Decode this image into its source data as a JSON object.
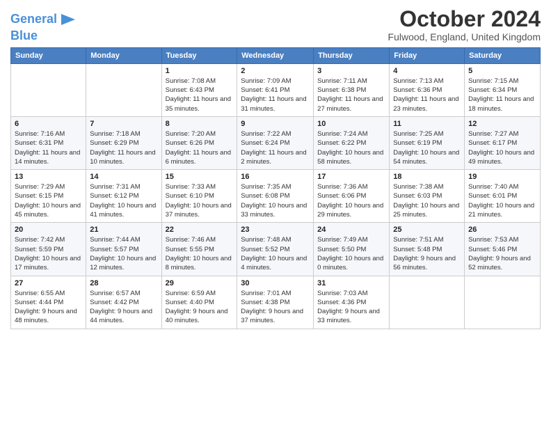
{
  "logo": {
    "line1": "General",
    "line2": "Blue"
  },
  "title": "October 2024",
  "location": "Fulwood, England, United Kingdom",
  "days_of_week": [
    "Sunday",
    "Monday",
    "Tuesday",
    "Wednesday",
    "Thursday",
    "Friday",
    "Saturday"
  ],
  "weeks": [
    [
      {
        "day": "",
        "info": ""
      },
      {
        "day": "",
        "info": ""
      },
      {
        "day": "1",
        "info": "Sunrise: 7:08 AM\nSunset: 6:43 PM\nDaylight: 11 hours and 35 minutes."
      },
      {
        "day": "2",
        "info": "Sunrise: 7:09 AM\nSunset: 6:41 PM\nDaylight: 11 hours and 31 minutes."
      },
      {
        "day": "3",
        "info": "Sunrise: 7:11 AM\nSunset: 6:38 PM\nDaylight: 11 hours and 27 minutes."
      },
      {
        "day": "4",
        "info": "Sunrise: 7:13 AM\nSunset: 6:36 PM\nDaylight: 11 hours and 23 minutes."
      },
      {
        "day": "5",
        "info": "Sunrise: 7:15 AM\nSunset: 6:34 PM\nDaylight: 11 hours and 18 minutes."
      }
    ],
    [
      {
        "day": "6",
        "info": "Sunrise: 7:16 AM\nSunset: 6:31 PM\nDaylight: 11 hours and 14 minutes."
      },
      {
        "day": "7",
        "info": "Sunrise: 7:18 AM\nSunset: 6:29 PM\nDaylight: 11 hours and 10 minutes."
      },
      {
        "day": "8",
        "info": "Sunrise: 7:20 AM\nSunset: 6:26 PM\nDaylight: 11 hours and 6 minutes."
      },
      {
        "day": "9",
        "info": "Sunrise: 7:22 AM\nSunset: 6:24 PM\nDaylight: 11 hours and 2 minutes."
      },
      {
        "day": "10",
        "info": "Sunrise: 7:24 AM\nSunset: 6:22 PM\nDaylight: 10 hours and 58 minutes."
      },
      {
        "day": "11",
        "info": "Sunrise: 7:25 AM\nSunset: 6:19 PM\nDaylight: 10 hours and 54 minutes."
      },
      {
        "day": "12",
        "info": "Sunrise: 7:27 AM\nSunset: 6:17 PM\nDaylight: 10 hours and 49 minutes."
      }
    ],
    [
      {
        "day": "13",
        "info": "Sunrise: 7:29 AM\nSunset: 6:15 PM\nDaylight: 10 hours and 45 minutes."
      },
      {
        "day": "14",
        "info": "Sunrise: 7:31 AM\nSunset: 6:12 PM\nDaylight: 10 hours and 41 minutes."
      },
      {
        "day": "15",
        "info": "Sunrise: 7:33 AM\nSunset: 6:10 PM\nDaylight: 10 hours and 37 minutes."
      },
      {
        "day": "16",
        "info": "Sunrise: 7:35 AM\nSunset: 6:08 PM\nDaylight: 10 hours and 33 minutes."
      },
      {
        "day": "17",
        "info": "Sunrise: 7:36 AM\nSunset: 6:06 PM\nDaylight: 10 hours and 29 minutes."
      },
      {
        "day": "18",
        "info": "Sunrise: 7:38 AM\nSunset: 6:03 PM\nDaylight: 10 hours and 25 minutes."
      },
      {
        "day": "19",
        "info": "Sunrise: 7:40 AM\nSunset: 6:01 PM\nDaylight: 10 hours and 21 minutes."
      }
    ],
    [
      {
        "day": "20",
        "info": "Sunrise: 7:42 AM\nSunset: 5:59 PM\nDaylight: 10 hours and 17 minutes."
      },
      {
        "day": "21",
        "info": "Sunrise: 7:44 AM\nSunset: 5:57 PM\nDaylight: 10 hours and 12 minutes."
      },
      {
        "day": "22",
        "info": "Sunrise: 7:46 AM\nSunset: 5:55 PM\nDaylight: 10 hours and 8 minutes."
      },
      {
        "day": "23",
        "info": "Sunrise: 7:48 AM\nSunset: 5:52 PM\nDaylight: 10 hours and 4 minutes."
      },
      {
        "day": "24",
        "info": "Sunrise: 7:49 AM\nSunset: 5:50 PM\nDaylight: 10 hours and 0 minutes."
      },
      {
        "day": "25",
        "info": "Sunrise: 7:51 AM\nSunset: 5:48 PM\nDaylight: 9 hours and 56 minutes."
      },
      {
        "day": "26",
        "info": "Sunrise: 7:53 AM\nSunset: 5:46 PM\nDaylight: 9 hours and 52 minutes."
      }
    ],
    [
      {
        "day": "27",
        "info": "Sunrise: 6:55 AM\nSunset: 4:44 PM\nDaylight: 9 hours and 48 minutes."
      },
      {
        "day": "28",
        "info": "Sunrise: 6:57 AM\nSunset: 4:42 PM\nDaylight: 9 hours and 44 minutes."
      },
      {
        "day": "29",
        "info": "Sunrise: 6:59 AM\nSunset: 4:40 PM\nDaylight: 9 hours and 40 minutes."
      },
      {
        "day": "30",
        "info": "Sunrise: 7:01 AM\nSunset: 4:38 PM\nDaylight: 9 hours and 37 minutes."
      },
      {
        "day": "31",
        "info": "Sunrise: 7:03 AM\nSunset: 4:36 PM\nDaylight: 9 hours and 33 minutes."
      },
      {
        "day": "",
        "info": ""
      },
      {
        "day": "",
        "info": ""
      }
    ]
  ]
}
